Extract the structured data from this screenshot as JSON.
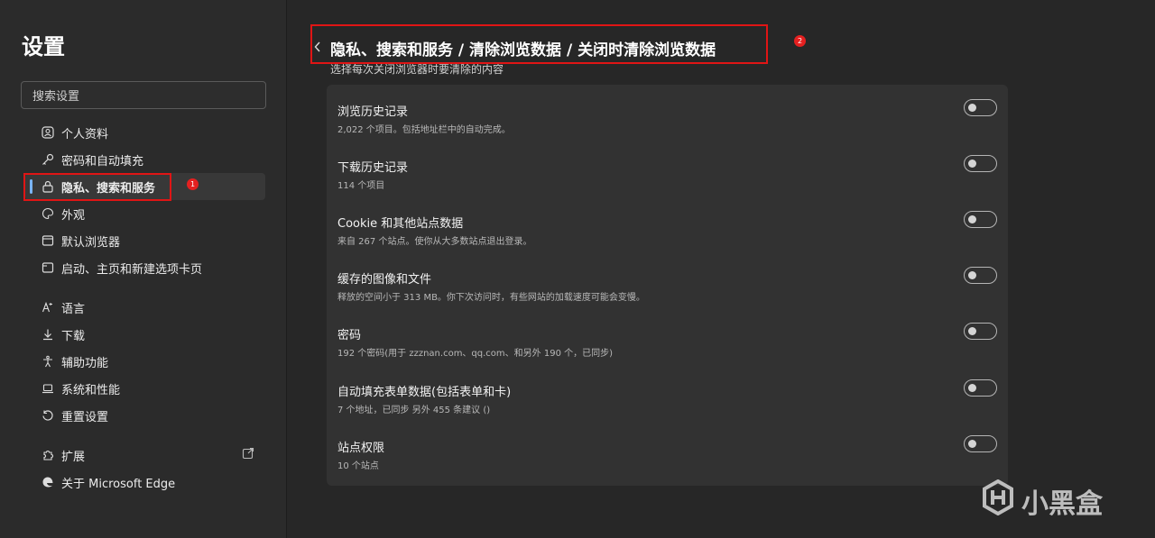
{
  "sidebar": {
    "title": "设置",
    "search_placeholder": "搜索设置",
    "items": [
      {
        "label": "个人资料",
        "icon": "profile-icon"
      },
      {
        "label": "密码和自动填充",
        "icon": "key-icon"
      },
      {
        "label": "隐私、搜索和服务",
        "icon": "lock-icon",
        "active": true
      },
      {
        "label": "外观",
        "icon": "palette-icon"
      },
      {
        "label": "默认浏览器",
        "icon": "browser-icon"
      },
      {
        "label": "启动、主页和新建选项卡页",
        "icon": "home-tab-icon"
      },
      {
        "label": "语言",
        "icon": "language-icon"
      },
      {
        "label": "下载",
        "icon": "download-icon"
      },
      {
        "label": "辅助功能",
        "icon": "accessibility-icon"
      },
      {
        "label": "系统和性能",
        "icon": "laptop-icon"
      },
      {
        "label": "重置设置",
        "icon": "reset-icon"
      },
      {
        "label": "扩展",
        "icon": "extension-icon"
      },
      {
        "label": "关于 Microsoft Edge",
        "icon": "edge-icon"
      }
    ]
  },
  "header": {
    "breadcrumb": "隐私、搜索和服务 / 清除浏览数据 / 关闭时清除浏览数据",
    "subtitle": "选择每次关闭浏览器时要清除的内容"
  },
  "rows": [
    {
      "title": "浏览历史记录",
      "desc": "2,022 个项目。包括地址栏中的自动完成。",
      "on": false
    },
    {
      "title": "下载历史记录",
      "desc": "114 个项目",
      "on": false
    },
    {
      "title": "Cookie 和其他站点数据",
      "desc": "来自 267 个站点。使你从大多数站点退出登录。",
      "on": false
    },
    {
      "title": "缓存的图像和文件",
      "desc": "释放的空间小于 313 MB。你下次访问时，有些网站的加载速度可能会变慢。",
      "on": false
    },
    {
      "title": "密码",
      "desc": "192 个密码(用于 zzznan.com、qq.com、和另外 190 个，已同步)",
      "on": false
    },
    {
      "title": "自动填充表单数据(包括表单和卡)",
      "desc": "7 个地址，已同步 另外 455 条建议 ()",
      "on": false
    },
    {
      "title": "站点权限",
      "desc": "10 个站点",
      "on": false
    }
  ],
  "annotations": [
    "1",
    "2"
  ],
  "watermark": "小黑盒",
  "colors": {
    "accent": "#7ab4f5",
    "annotation": "#e01515",
    "background": "#272727"
  }
}
